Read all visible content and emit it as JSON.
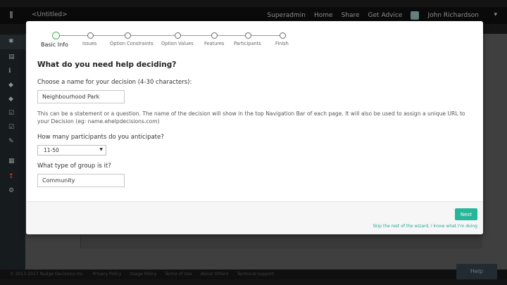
{
  "app": {
    "brand": "<Untitled>",
    "user_role": "Superadmin",
    "nav": [
      "Home",
      "Share",
      "Get Advice"
    ],
    "user_name": "John Richardson",
    "help_label": "Help",
    "footer_links": [
      "© 2013-2017 Nudge Decisions Inc.",
      "Privacy Policy",
      "Usage Policy",
      "Terms of Use",
      "About Others",
      "Technical support"
    ]
  },
  "wizard": {
    "steps": [
      {
        "label": "Basic Info",
        "active": true
      },
      {
        "label": "Issues",
        "active": false
      },
      {
        "label": "Option Constraints",
        "active": false
      },
      {
        "label": "Option Values",
        "active": false
      },
      {
        "label": "Features",
        "active": false
      },
      {
        "label": "Participants",
        "active": false
      },
      {
        "label": "Finish",
        "active": false
      }
    ],
    "heading": "What do you need help deciding?",
    "name_label": "Choose a name for your decision (4-30 characters):",
    "name_value": "Neighbourhood Park",
    "help_text": "This can be a statement or a question. The name of the decision will show in the top Navigation Bar of each page. It will also be used to assign a unique URL to your Decision (eg: name.ehelpdecisions.com)",
    "participants_label": "How many participants do you anticipate?",
    "participants_value": "11-50",
    "group_label": "What type of group is it?",
    "group_value": "Community",
    "next_label": "Next",
    "skip_label": "Skip the rest of the wizard, I know what I'm doing"
  },
  "colors": {
    "accent": "#26b699",
    "active_step": "#4caf50"
  }
}
